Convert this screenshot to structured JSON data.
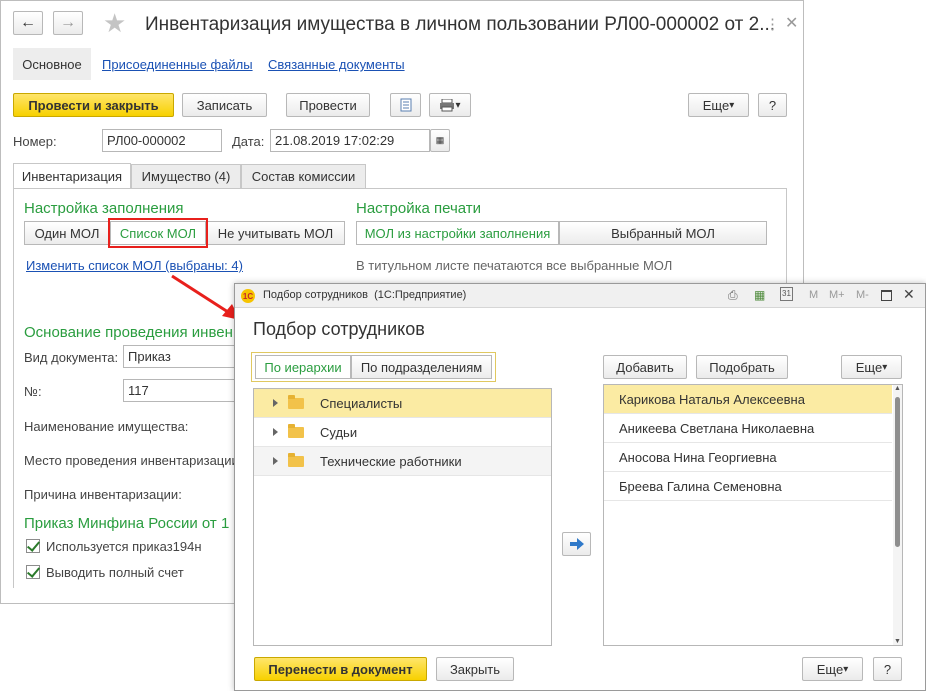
{
  "main_window": {
    "title": "Инвентаризация имущества в личном пользовании РЛ00-000002 от 2...",
    "nav": {
      "main": "Основное",
      "files": "Присоединенные файлы",
      "docs": "Связанные документы"
    },
    "toolbar": {
      "post_close": "Провести и закрыть",
      "save": "Записать",
      "post": "Провести",
      "more": "Еще",
      "help": "?"
    },
    "number_label": "Номер:",
    "number_value": "РЛ00-000002",
    "date_label": "Дата:",
    "date_value": "21.08.2019 17:02:29",
    "tabs": [
      "Инвентаризация",
      "Имущество (4)",
      "Состав комиссии"
    ],
    "fill_settings": {
      "title": "Настройка заполнения",
      "options": [
        "Один МОЛ",
        "Список МОЛ",
        "Не учитывать МОЛ"
      ],
      "change_link": "Изменить список МОЛ (выбраны: 4)"
    },
    "print_settings": {
      "title": "Настройка печати",
      "options": [
        "МОЛ из настройки заполнения",
        "Выбранный МОЛ"
      ],
      "note": "В титульном листе печатаются все выбранные МОЛ"
    },
    "basis": {
      "title": "Основание проведения инвен",
      "doc_type_label": "Вид документа:",
      "doc_type_value": "Приказ",
      "num_label": "№:",
      "num_value": "117",
      "property_label": "Наименование имущества:",
      "place_label": "Место проведения инвентаризации",
      "reason_label": "Причина инвентаризации:"
    },
    "order": {
      "title": "Приказ Минфина России от 1",
      "check1": "Используется приказ194н",
      "check2": "Выводить полный счет"
    }
  },
  "dialog": {
    "window_title": "Подбор сотрудников  (1С:Предприятие)",
    "title_buttons": [
      "M",
      "M+",
      "M-"
    ],
    "heading": "Подбор сотрудников",
    "view_options": [
      "По иерархии",
      "По подразделениям"
    ],
    "tree": [
      "Специалисты",
      "Судьи",
      "Технические работники"
    ],
    "right_toolbar": {
      "add": "Добавить",
      "pick": "Подобрать",
      "more": "Еще"
    },
    "selected": [
      "Карикова Наталья Алексеевна",
      "Аникеева Светлана Николаевна",
      "Аносова Нина Георгиевна",
      "Бреева Галина Семеновна"
    ],
    "footer": {
      "transfer": "Перенести в документ",
      "close": "Закрыть",
      "more": "Еще",
      "help": "?"
    }
  },
  "colors": {
    "accent_green": "#2a9d3f",
    "highlight_red": "#e8201c",
    "selected_row": "#fbeba3",
    "primary_yellow": "#f7d100"
  }
}
